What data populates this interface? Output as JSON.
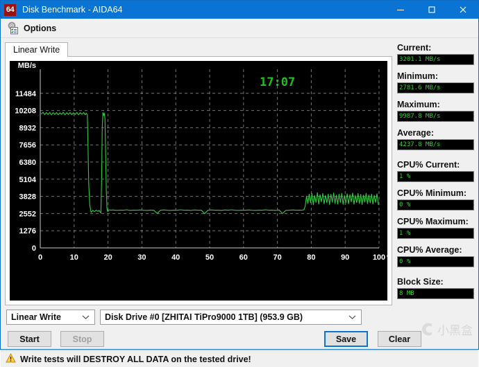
{
  "window": {
    "icon_text": "64",
    "title": "Disk Benchmark - AIDA64",
    "minimize_label": "Minimize",
    "maximize_label": "Maximize",
    "close_label": "Close"
  },
  "toolbar": {
    "options_label": "Options",
    "options_icon": "options-gear-checklist-icon"
  },
  "tabs": [
    {
      "label": "Linear Write",
      "active": true
    }
  ],
  "stats": [
    {
      "name": "current",
      "label": "Current:",
      "value": "3201.1 MB/s",
      "gap": false
    },
    {
      "name": "minimum",
      "label": "Minimum:",
      "value": "2781.6 MB/s",
      "gap": false
    },
    {
      "name": "maximum",
      "label": "Maximum:",
      "value": "9987.8 MB/s",
      "gap": false
    },
    {
      "name": "average",
      "label": "Average:",
      "value": "4237.8 MB/s",
      "gap": true
    },
    {
      "name": "cpu-current",
      "label": "CPU% Current:",
      "value": "1 %",
      "gap": false
    },
    {
      "name": "cpu-minimum",
      "label": "CPU% Minimum:",
      "value": "0 %",
      "gap": false
    },
    {
      "name": "cpu-maximum",
      "label": "CPU% Maximum:",
      "value": "1 %",
      "gap": false
    },
    {
      "name": "cpu-average",
      "label": "CPU% Average:",
      "value": "0 %",
      "gap": true
    },
    {
      "name": "block-size",
      "label": "Block Size:",
      "value": "8 MB",
      "gap": false
    }
  ],
  "controls": {
    "test_type": "Linear Write",
    "drive": "Disk Drive #0  [ZHITAI TiPro9000 1TB]  (953.9 GB)",
    "start_label": "Start",
    "stop_label": "Stop",
    "save_label": "Save",
    "clear_label": "Clear"
  },
  "warning": {
    "icon": "warning-triangle-icon",
    "text": "Write tests will DESTROY ALL DATA on the tested drive!"
  },
  "watermark": {
    "text": "小黑盒"
  },
  "colors": {
    "titlebar": "#0a74d4",
    "plot_background": "#000000",
    "trace": "#2ecc40",
    "grid": "#9a9a9a",
    "axis_text": "#ffffff",
    "lcd_green": "#28d428",
    "accent": "#0a74d4"
  },
  "chart_data": {
    "type": "line",
    "title": "",
    "timestamp": "17:07",
    "ylabel": "MB/s",
    "xlabel": "%",
    "xlim": [
      0,
      100
    ],
    "ylim": [
      0,
      12760
    ],
    "grid": true,
    "legend": "none",
    "yticks": [
      0,
      1276,
      2552,
      3828,
      5104,
      6380,
      7656,
      8932,
      10208,
      11484
    ],
    "ytick_labels": [
      "0",
      "1276",
      "2552",
      "3828",
      "5104",
      "6380",
      "7656",
      "8932",
      "10208",
      "11484"
    ],
    "xticks": [
      0,
      10,
      20,
      30,
      40,
      50,
      60,
      70,
      80,
      90,
      100
    ],
    "xtick_labels": [
      "0",
      "10",
      "20",
      "30",
      "40",
      "50",
      "60",
      "70",
      "80",
      "90",
      "100"
    ],
    "xtick_suffix": "%",
    "series": [
      {
        "name": "Linear Write",
        "color": "#2ecc40",
        "x": [
          0.3,
          0.8,
          1.3,
          1.8,
          2.3,
          2.8,
          3.3,
          3.8,
          4.3,
          4.8,
          5.3,
          5.8,
          6.3,
          6.8,
          7.3,
          7.8,
          8.3,
          8.8,
          9.3,
          9.8,
          10.3,
          10.8,
          11.3,
          11.8,
          12.3,
          12.8,
          13.3,
          13.6,
          13.9,
          14.1,
          14.3,
          14.6,
          15.0,
          15.5,
          16.0,
          16.5,
          17.0,
          17.4,
          17.7,
          17.9,
          18.1,
          18.3,
          18.5,
          18.7,
          18.9,
          19.1,
          19.3,
          19.5,
          19.7,
          19.9,
          20.3,
          20.8,
          21.5,
          22.5,
          23.5,
          24.5,
          25.5,
          26.5,
          27.5,
          28.5,
          29.5,
          30.5,
          31.5,
          32.5,
          33.5,
          34.5,
          35.5,
          36.5,
          37.5,
          38.5,
          39.5,
          40.5,
          41.5,
          42.5,
          43.5,
          44.5,
          45.5,
          46.5,
          47.5,
          48.5,
          49.5,
          50.5,
          51.5,
          52.5,
          53.5,
          54.5,
          55.5,
          56.5,
          57.5,
          58.5,
          59.5,
          60.5,
          61.5,
          62.5,
          63.5,
          64.5,
          65.5,
          66.5,
          67.5,
          68.5,
          69.5,
          70.5,
          71.5,
          72.5,
          73.5,
          74.5,
          75.5,
          76.5,
          77.2,
          77.8,
          78.2,
          78.6,
          79.0,
          79.4,
          79.8,
          80.2,
          80.6,
          81.0,
          81.4,
          81.8,
          82.2,
          82.6,
          83.0,
          83.4,
          83.8,
          84.2,
          84.6,
          85.0,
          85.4,
          85.8,
          86.2,
          86.6,
          87.0,
          87.4,
          87.8,
          88.2,
          88.6,
          89.0,
          89.4,
          89.8,
          90.2,
          90.6,
          91.0,
          91.4,
          91.8,
          92.2,
          92.6,
          93.0,
          93.4,
          93.8,
          94.2,
          94.6,
          95.0,
          95.4,
          95.8,
          96.2,
          96.6,
          97.0,
          97.4,
          97.8,
          98.2,
          98.6,
          99.0,
          99.4,
          99.8
        ],
        "y": [
          9940,
          10080,
          9900,
          10060,
          9910,
          10070,
          9890,
          10050,
          9920,
          10060,
          9900,
          10040,
          9930,
          10070,
          9890,
          10050,
          9910,
          10060,
          9900,
          10040,
          9920,
          10070,
          9890,
          10050,
          9930,
          10060,
          9900,
          10020,
          9880,
          7500,
          4800,
          3200,
          2640,
          2790,
          2700,
          2800,
          2720,
          2790,
          2650,
          2600,
          5000,
          9000,
          10050,
          9850,
          10020,
          9600,
          7000,
          4200,
          2900,
          2700,
          2830,
          2800,
          2820,
          2790,
          2810,
          2800,
          2830,
          2790,
          2810,
          2800,
          2820,
          2800,
          2790,
          2810,
          2800,
          2560,
          2800,
          2820,
          2800,
          2790,
          2810,
          2800,
          2830,
          2800,
          2810,
          2790,
          2820,
          2800,
          2810,
          2550,
          2800,
          2820,
          2800,
          2810,
          2790,
          2820,
          2800,
          2830,
          2800,
          2790,
          2810,
          2800,
          2820,
          2800,
          2790,
          2810,
          2800,
          2830,
          2800,
          2810,
          2790,
          2820,
          2560,
          2790,
          2800,
          2820,
          2800,
          2810,
          2800,
          2830,
          3100,
          3850,
          3300,
          4000,
          3350,
          4050,
          3200,
          3900,
          3380,
          4100,
          3250,
          3950,
          3420,
          4050,
          3280,
          3900,
          3350,
          4000,
          3220,
          3980,
          3400,
          4080,
          3300,
          3920,
          3260,
          4000,
          3380,
          4050,
          3240,
          3900,
          3340,
          4020,
          3280,
          3960,
          3420,
          4080,
          3250,
          3900,
          3360,
          4040,
          3300,
          3980,
          3220,
          3920,
          3400,
          4060,
          3280,
          3940,
          3340,
          4000,
          3260,
          3900,
          3380,
          4020,
          3201
        ]
      }
    ]
  }
}
